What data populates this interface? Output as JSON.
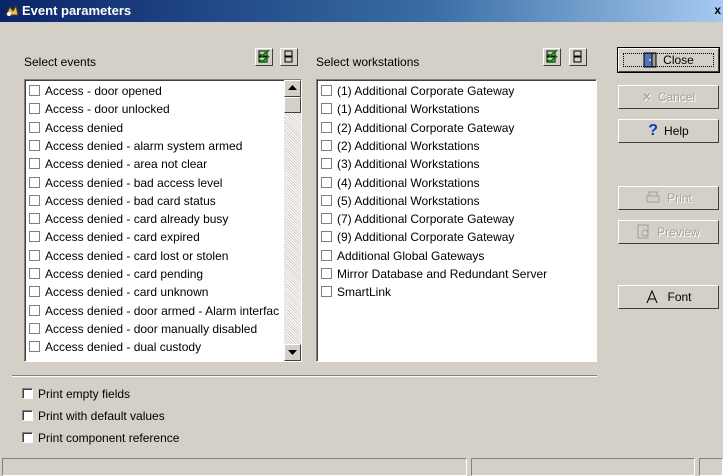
{
  "window": {
    "title": "Event parameters",
    "close_glyph": "x"
  },
  "events_panel": {
    "label": "Select events",
    "items": [
      "Access - door opened",
      "Access - door unlocked",
      "Access denied",
      "Access denied - alarm system armed",
      "Access denied - area not clear",
      "Access denied - bad access level",
      "Access denied - bad card status",
      "Access denied - card already busy",
      "Access denied - card expired",
      "Access denied - card lost or stolen",
      "Access denied - card pending",
      "Access denied - card unknown",
      "Access denied - door armed - Alarm interfac",
      "Access denied - door manually disabled",
      "Access denied - dual custody"
    ]
  },
  "workstations_panel": {
    "label": "Select workstations",
    "items": [
      "(1) Additional Corporate Gateway",
      "(1) Additional Workstations",
      "(2) Additional Corporate Gateway",
      "(2) Additional Workstations",
      "(3) Additional Workstations",
      "(4) Additional Workstations",
      "(5) Additional Workstations",
      "(7) Additional Corporate Gateway",
      "(9) Additional Corporate Gateway",
      "Additional Global Gateways",
      "Mirror Database and Redundant Server",
      "SmartLink"
    ]
  },
  "buttons": {
    "close": "Close",
    "cancel": "Cancel",
    "help": "Help",
    "print": "Print",
    "preview": "Preview",
    "font": "Font"
  },
  "options": {
    "print_empty_fields": "Print empty fields",
    "print_default_values": "Print with default values",
    "print_component_reference": "Print component reference"
  },
  "colors": {
    "titlebar": "#0a246a",
    "face": "#d4d0c8"
  }
}
